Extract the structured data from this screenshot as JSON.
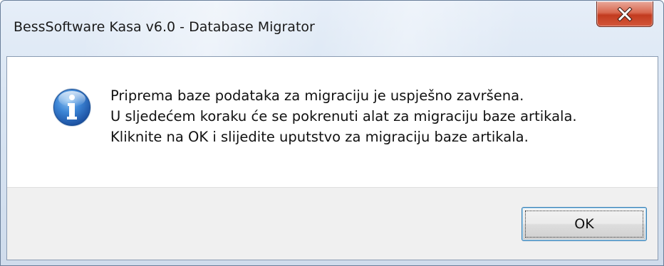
{
  "window": {
    "title": "BessSoftware Kasa v6.0 - Database Migrator"
  },
  "icons": {
    "close": "close-icon",
    "message": "information-icon"
  },
  "colors": {
    "close_button": "#c8452a",
    "info_icon": "#1f5fb0",
    "focus_border": "#3c7fb1"
  },
  "message": {
    "lines": [
      "Priprema baze podataka za migraciju je uspješno završena.",
      "U sljedećem koraku će se pokrenuti alat za migraciju baze artikala.",
      "Kliknite na OK i slijedite uputstvo za migraciju baze artikala."
    ]
  },
  "buttons": {
    "ok_label": "OK"
  }
}
